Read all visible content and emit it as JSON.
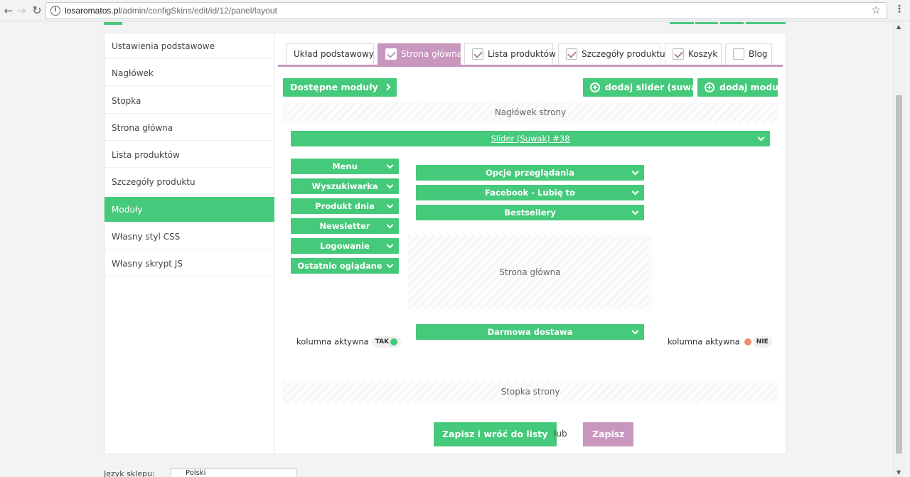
{
  "browser": {
    "url_host": "losaromatos.pl",
    "url_path": "/admin/configSkins/edit/id/12/panel/layout"
  },
  "sidebar": {
    "items": [
      {
        "label": "Ustawienia podstawowe"
      },
      {
        "label": "Nagłówek"
      },
      {
        "label": "Stopka"
      },
      {
        "label": "Strona główna"
      },
      {
        "label": "Lista produktów"
      },
      {
        "label": "Szczegóły produktu"
      },
      {
        "label": "Moduły",
        "active": true
      },
      {
        "label": "Własny styl CSS"
      },
      {
        "label": "Własny skrypt JS"
      }
    ]
  },
  "tabs": [
    {
      "label": "Układ podstawowy",
      "checkbox": false,
      "active": false
    },
    {
      "label": "Strona główna",
      "checkbox": true,
      "checked": true,
      "active": true
    },
    {
      "label": "Lista produktów",
      "checkbox": true,
      "checked": true,
      "active": false
    },
    {
      "label": "Szczegóły produktu",
      "checkbox": true,
      "checked": true,
      "active": false
    },
    {
      "label": "Koszyk",
      "checkbox": true,
      "checked": true,
      "active": false
    },
    {
      "label": "Blog",
      "checkbox": true,
      "checked": false,
      "active": false
    }
  ],
  "toolbar": {
    "available_modules": "Dostępne moduły",
    "add_slider": "dodaj slider (suwak)",
    "add_module": "dodaj moduł"
  },
  "zones": {
    "header": "Nagłówek strony",
    "main": "Strona główna",
    "footer": "Stopka strony"
  },
  "slider_module": "Slider (Suwak) #38",
  "left_column": {
    "modules": [
      "Menu",
      "Wyszukiwarka",
      "Produkt dnia",
      "Newsletter",
      "Logowanie",
      "Ostatnio oglądane"
    ],
    "status_label": "kolumna aktywna",
    "status_value": "TAK"
  },
  "center_column": {
    "top_modules": [
      "Opcje przeglądania",
      "Facebook - Lubię to",
      "Bestsellery"
    ],
    "bottom_modules": [
      "Darmowa dostawa"
    ]
  },
  "right_column": {
    "status_label": "kolumna aktywna",
    "status_value": "NIE"
  },
  "actions": {
    "save_and_back": "Zapisz i wróć do listy",
    "or": "lub",
    "save": "Zapisz"
  },
  "bottom": {
    "label": "Język sklepu:",
    "input_value": "Polski"
  },
  "colors": {
    "green": "#45c97a",
    "purple": "#c996bd",
    "off": "#f08a6b"
  }
}
